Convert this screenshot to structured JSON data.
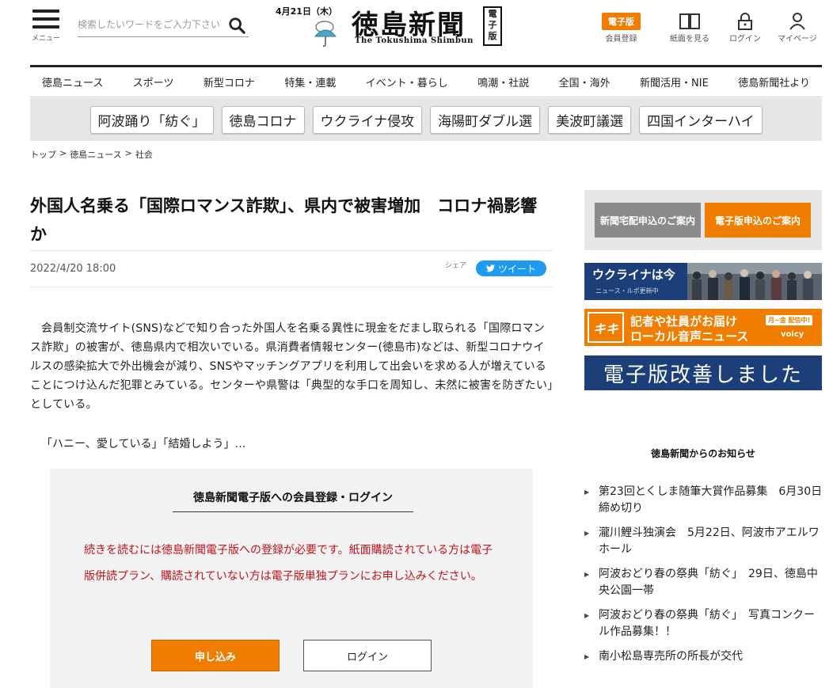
{
  "header": {
    "menu_label": "メニュー",
    "search_placeholder": "検索したいワードをご入力下さい",
    "date": "4月21日（木）",
    "logo_jp": "徳島新聞",
    "logo_en": "The Tokushima Shimbun",
    "logo_badge": "電子版",
    "tools": [
      {
        "label": "会員登録",
        "pill": "電子版"
      },
      {
        "label": "紙面を見る"
      },
      {
        "label": "ログイン"
      },
      {
        "label": "マイページ"
      }
    ]
  },
  "nav": [
    "徳島ニュース",
    "スポーツ",
    "新型コロナ",
    "特集・連載",
    "イベント・暮らし",
    "鳴潮・社説",
    "全国・海外",
    "新聞活用・NIE",
    "徳島新聞社より"
  ],
  "tags": [
    "阿波踊り「紡ぐ」",
    "徳島コロナ",
    "ウクライナ侵攻",
    "海陽町ダブル選",
    "美波町議選",
    "四国インターハイ"
  ],
  "breadcrumb": [
    "トップ",
    "徳島ニュース",
    "社会"
  ],
  "article": {
    "title": "外国人名乗る「国際ロマンス詐欺」、県内で被害増加　コロナ禍影響か",
    "date": "2022/4/20 18:00",
    "share_label": "シェア",
    "tweet_label": "ツイート",
    "body": "会員制交流サイト(SNS)などで知り合った外国人を名乗る異性に現金をだまし取られる「国際ロマンス詐欺」の被害が、徳島県内で相次いでいる。県消費者情報センター(徳島市)などは、新型コロナウイルスの感染拡大で外出機会が減り、SNSやマッチングアプリを利用して出会いを求める人が増えていることにつけ込んだ犯罪とみている。センターや県警は「典型的な手口を周知し、未然に被害を防ぎたい」としている。",
    "body_teaser": "「ハニー、愛している」「結婚しよう」…"
  },
  "paywall": {
    "title": "徳島新聞電子版への会員登録・ログイン",
    "message": "続きを読むには徳島新聞電子版への登録が必要です。紙面購読されている方は電子版併読プラン、購読されていない方は電子版単独プランにお申し込みください。",
    "apply_label": "申し込み",
    "login_label": "ログイン"
  },
  "sidebar": {
    "btn_delivery": "新聞宅配申込のご案内",
    "btn_digital": "電子版申込のご案内",
    "ukraine_title": "ウクライナは今",
    "ukraine_sub": "ニュース・ルポ更新中",
    "voice_logo": "キキ",
    "voice_line1": "記者や社員がお届け",
    "voice_line2": "ローカル音声ニュース",
    "voice_pill": "月~金 配信中!",
    "voice_brand": "voicy",
    "improve": "電子版改善しました",
    "notice_heading": "徳島新聞からのお知らせ",
    "notices": [
      "第23回とくしま随筆大賞作品募集　6月30日締め切り",
      "瀧川鯉斗独演会　5月22日、阿波市アエルワホール",
      "阿波おどり春の祭典「紡ぐ」　29日、徳島中央公園一帯",
      "阿波おどり春の祭典「紡ぐ」　写真コンクール作品募集！！",
      "南小松島専売所の所長が交代"
    ]
  },
  "colors": {
    "accent": "#f07d00",
    "navy": "#1d3f79",
    "twitter": "#1d9bf0",
    "alert": "#c0121d"
  }
}
